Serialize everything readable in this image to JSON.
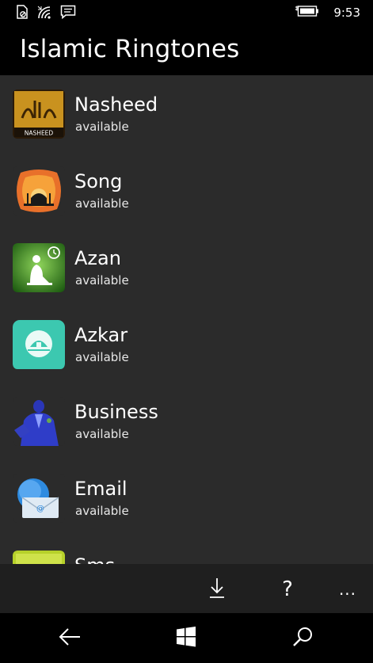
{
  "status_bar": {
    "time": "9:53",
    "icons": [
      "no-sim-icon",
      "wifi-icon",
      "message-icon",
      "battery-charging-icon"
    ]
  },
  "app": {
    "title": "Islamic Ringtones"
  },
  "list": {
    "items": [
      {
        "title": "Nasheed",
        "status": "available",
        "icon": "nasheed-icon",
        "icon_text": "NASHEED"
      },
      {
        "title": "Song",
        "status": "available",
        "icon": "mosque-icon"
      },
      {
        "title": "Azan",
        "status": "available",
        "icon": "prayer-clock-icon"
      },
      {
        "title": "Azkar",
        "status": "available",
        "icon": "azkar-icon"
      },
      {
        "title": "Business",
        "status": "available",
        "icon": "businessman-icon"
      },
      {
        "title": "Email",
        "status": "available",
        "icon": "email-icon"
      },
      {
        "title": "Sms",
        "status": "",
        "icon": "sms-icon"
      }
    ]
  },
  "app_bar": {
    "buttons": [
      "download-icon",
      "help-icon",
      "more-icon"
    ],
    "help_glyph": "?",
    "more_glyph": "..."
  },
  "nav_bar": {
    "buttons": [
      "back-icon",
      "windows-icon",
      "search-icon"
    ]
  },
  "colors": {
    "list_background": "#2b2b2b",
    "app_bar_background": "#1f1f1f",
    "chrome_background": "#000000",
    "text": "#ffffff"
  }
}
